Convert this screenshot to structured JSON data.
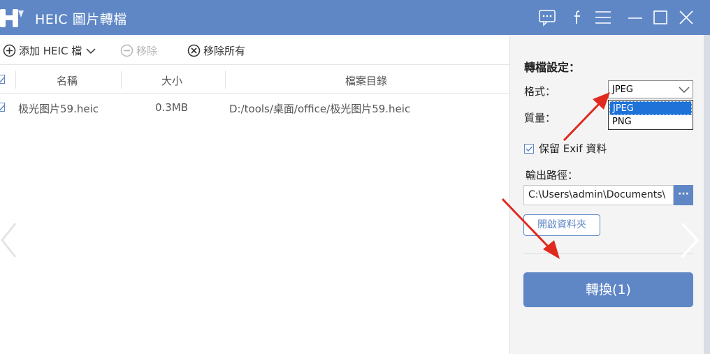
{
  "app": {
    "title": "HEIC 圖片轉檔"
  },
  "toolbar": {
    "add_label": "添加 HEIC 檔",
    "remove_label": "移除",
    "remove_all_label": "移除所有"
  },
  "table": {
    "columns": [
      "名稱",
      "大小",
      "檔案目錄"
    ],
    "rows": [
      {
        "name": "极光图片59.heic",
        "size": "0.3MB",
        "path": "D:/tools/桌面/office/极光图片59.heic"
      }
    ]
  },
  "settings": {
    "title": "轉檔設定：",
    "format_label": "格式：",
    "format_value": "JPEG",
    "format_options": [
      "JPEG",
      "PNG"
    ],
    "quality_label": "質量：",
    "exif_label": "保留 Exif 資料",
    "output_label": "輸出路徑：",
    "output_path": "C:\\Users\\admin\\Documents\\",
    "browse_label": "···",
    "open_folder_label": "開啟資料夾",
    "convert_label": "轉換(1)"
  },
  "colors": {
    "accent": "#5f87c6",
    "annotation_arrow": "#e02a1f",
    "selection": "#1e72d8"
  }
}
